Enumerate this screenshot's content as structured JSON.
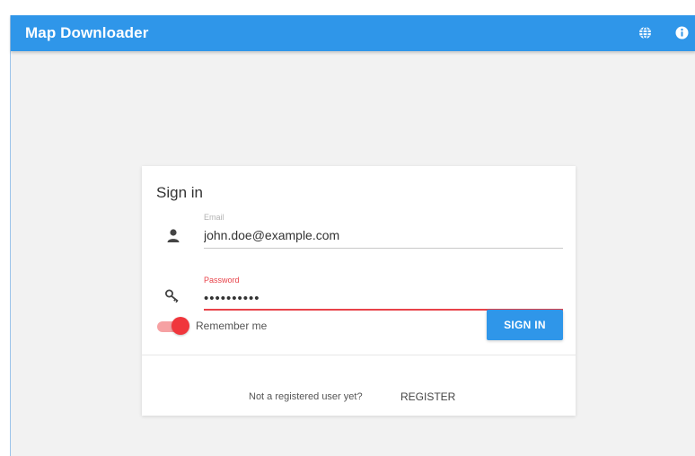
{
  "app": {
    "title": "Map Downloader",
    "accent_color": "#2f96e9",
    "icons": [
      "globe-icon",
      "info-icon"
    ]
  },
  "login": {
    "title": "Sign in",
    "email": {
      "label": "Email",
      "value": "john.doe@example.com",
      "icon": "person-icon"
    },
    "password": {
      "label": "Password",
      "value": "••••••••••",
      "icon": "key-icon",
      "focused": true,
      "focus_color": "#e8434a"
    },
    "remember": {
      "label": "Remember me",
      "checked": true,
      "color": "#f0363c"
    },
    "submit_label": "SIGN IN",
    "register_prompt": "Not a registered user yet?",
    "register_label": "REGISTER"
  }
}
